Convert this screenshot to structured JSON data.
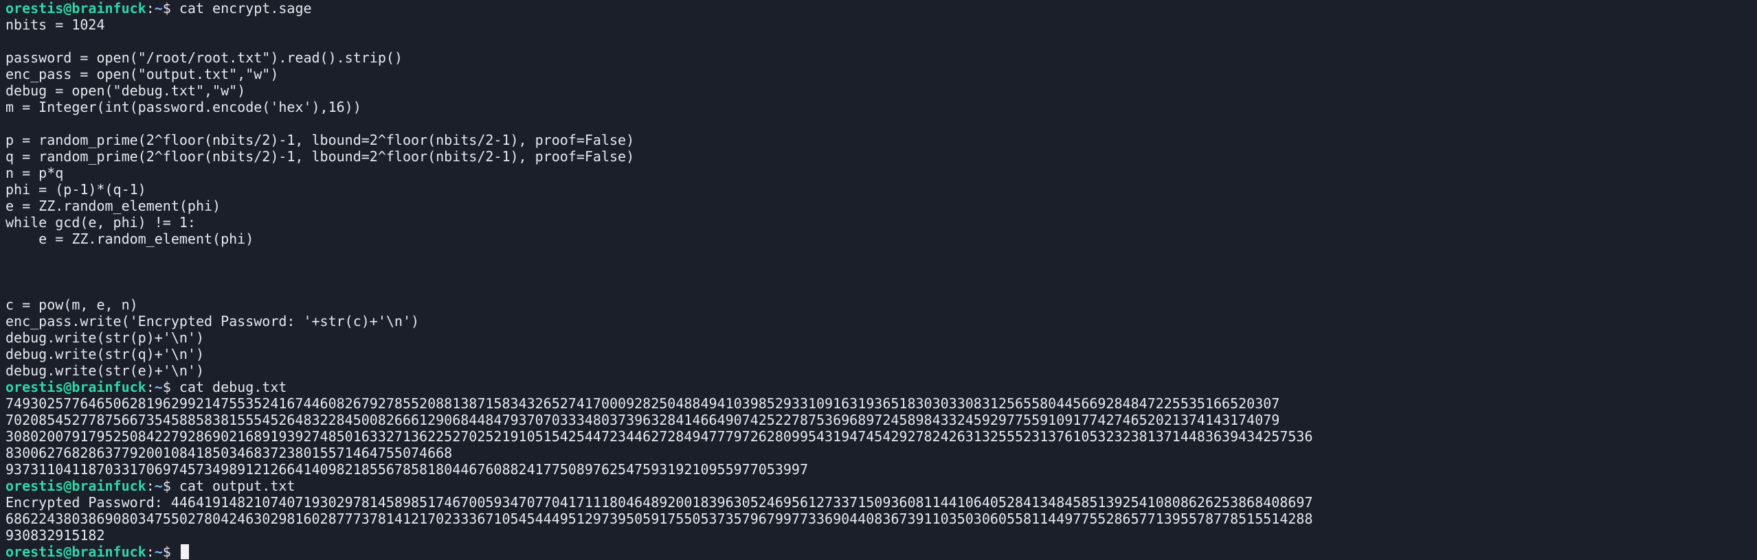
{
  "colors": {
    "background": "#1b1f2a",
    "text": "#e6e9ef",
    "user_host": "#2fd6a7",
    "path": "#7fb3ff",
    "cursor": "#f2f2f2"
  },
  "prompt": {
    "user_host": "orestis@brainfuck",
    "separator": ":",
    "path": "~",
    "symbol": "$ "
  },
  "lines": [
    {
      "type": "prompt",
      "cmd": "cat encrypt.sage"
    },
    {
      "text": "nbits = 1024"
    },
    {
      "text": ""
    },
    {
      "text": "password = open(\"/root/root.txt\").read().strip()"
    },
    {
      "text": "enc_pass = open(\"output.txt\",\"w\")"
    },
    {
      "text": "debug = open(\"debug.txt\",\"w\")"
    },
    {
      "text": "m = Integer(int(password.encode('hex'),16))"
    },
    {
      "text": ""
    },
    {
      "text": "p = random_prime(2^floor(nbits/2)-1, lbound=2^floor(nbits/2-1), proof=False)"
    },
    {
      "text": "q = random_prime(2^floor(nbits/2)-1, lbound=2^floor(nbits/2-1), proof=False)"
    },
    {
      "text": "n = p*q"
    },
    {
      "text": "phi = (p-1)*(q-1)"
    },
    {
      "text": "e = ZZ.random_element(phi)"
    },
    {
      "text": "while gcd(e, phi) != 1:"
    },
    {
      "text": "    e = ZZ.random_element(phi)"
    },
    {
      "text": ""
    },
    {
      "text": ""
    },
    {
      "text": ""
    },
    {
      "text": "c = pow(m, e, n)"
    },
    {
      "text": "enc_pass.write('Encrypted Password: '+str(c)+'\\n')"
    },
    {
      "text": "debug.write(str(p)+'\\n')"
    },
    {
      "text": "debug.write(str(q)+'\\n')"
    },
    {
      "text": "debug.write(str(e)+'\\n')"
    },
    {
      "type": "prompt",
      "cmd": "cat debug.txt"
    },
    {
      "text": "7493025776465062819629921475535241674460826792785520881387158343265274170009282504884941039852933109163193651830303308312565580445669284847225535166520307"
    },
    {
      "text": "7020854527787566735458858381555452648322845008266612906844847937070333480373963284146649074252278753696897245898433245929775591091774274652021374143174079"
    },
    {
      "text": "30802007917952508422792869021689193927485016332713622527025219105154254472344627284947779726280995431947454292782426313255523137610532323813714483639434257536830062768286377920010841850346837238015571464755074668"
    },
    {
      "text": "9373110411870331706974573498912126641409821855678581804467608824177508976254759319210955977053997"
    },
    {
      "type": "prompt",
      "cmd": "cat output.txt"
    },
    {
      "text": "Encrypted Password: 44641914821074071930297814589851746700593470770417111804648920018396305246956127337150936081144106405284134845851392541080862625386840869768622438038690803475502780424630298160287773781412170233367105454449512973950591755053735796799773369044083673911035030605581144977552865771395578778515514288930832915182"
    },
    {
      "type": "prompt",
      "cmd": "",
      "cursor": true
    }
  ]
}
